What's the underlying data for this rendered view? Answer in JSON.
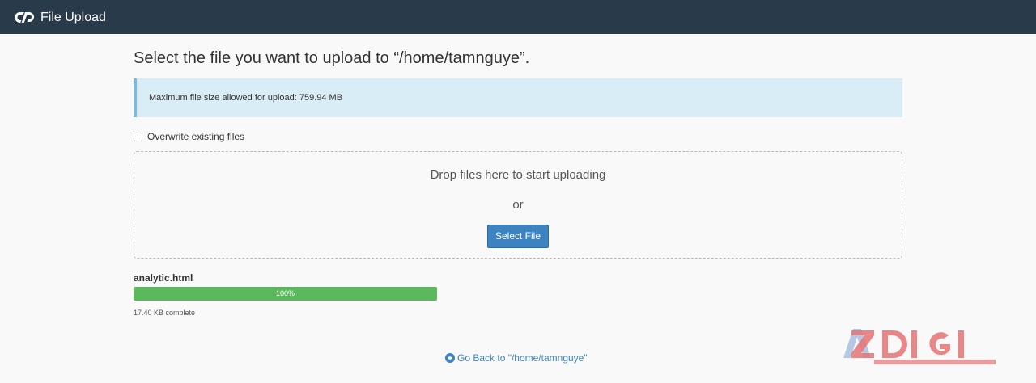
{
  "app": {
    "title": "File Upload",
    "logo_icon": "cpanel-logo-icon"
  },
  "page": {
    "heading": "Select the file you want to upload to “/home/tamnguye”."
  },
  "info": {
    "message": "Maximum file size allowed for upload: 759.94 MB"
  },
  "options": {
    "overwrite_label": "Overwrite existing files",
    "overwrite_checked": false
  },
  "dropzone": {
    "drop_text": "Drop files here to start uploading",
    "or_text": "or",
    "select_button_label": "Select File"
  },
  "upload": {
    "file_name": "analytic.html",
    "progress": 1.0,
    "progress_label": "100%",
    "status_text": "17.40 KB complete"
  },
  "footer": {
    "go_back_label": "Go Back to \"/home/tamnguye\"",
    "go_back_icon": "circle-arrow-left-icon"
  },
  "watermark": {
    "text": "AZDIGI"
  },
  "colors": {
    "topbar": "#293a4a",
    "info_background": "#d9edf7",
    "accent": "#3d83c1",
    "progress_fill": "#5cb85c"
  }
}
